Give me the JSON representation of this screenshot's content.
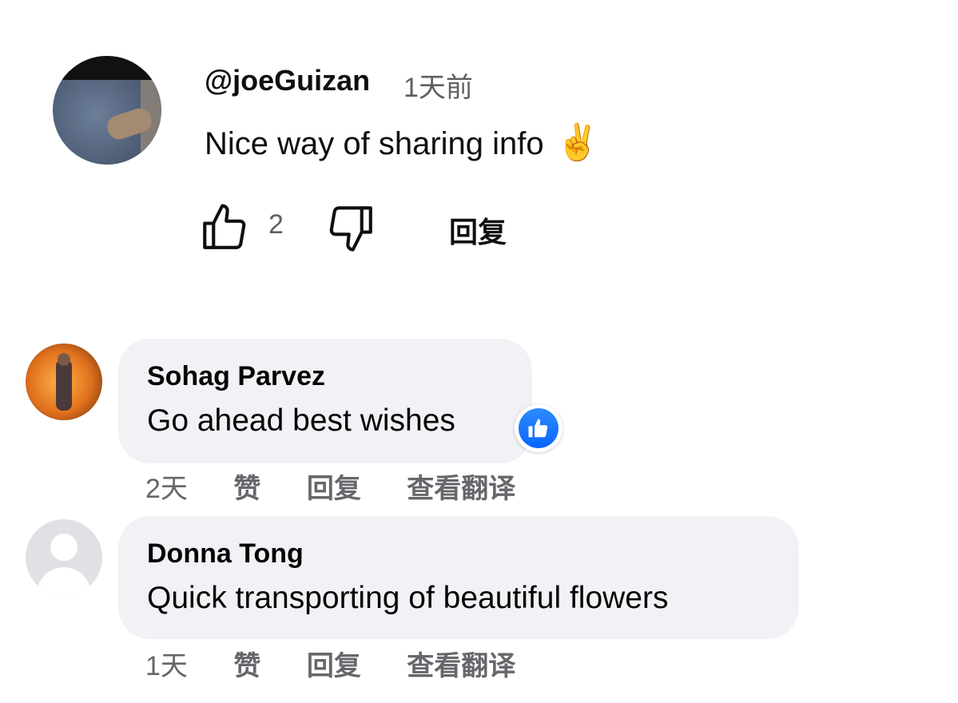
{
  "youtube_comment": {
    "author": "@joeGuizan",
    "time": "1天前",
    "text": "Nice way of sharing info",
    "emoji": "✌️",
    "like_count": "2",
    "reply_label": "回复",
    "like_icon": "thumbs-up-icon",
    "dislike_icon": "thumbs-down-icon"
  },
  "facebook_comments": [
    {
      "author": "Sohag Parvez",
      "text": "Go ahead best wishes",
      "reaction": "like-reaction-icon",
      "time": "2天",
      "like_label": "赞",
      "reply_label": "回复",
      "translate_label": "查看翻译"
    },
    {
      "author": "Donna Tong",
      "text": "Quick transporting of beautiful flowers",
      "time": "1天",
      "like_label": "赞",
      "reply_label": "回复",
      "translate_label": "查看翻译"
    }
  ],
  "colors": {
    "fb_bubble": "#f0f2f5",
    "fb_secondary_text": "#65676b",
    "yt_secondary_text": "#606060",
    "fb_like_blue": "#0866ff"
  }
}
